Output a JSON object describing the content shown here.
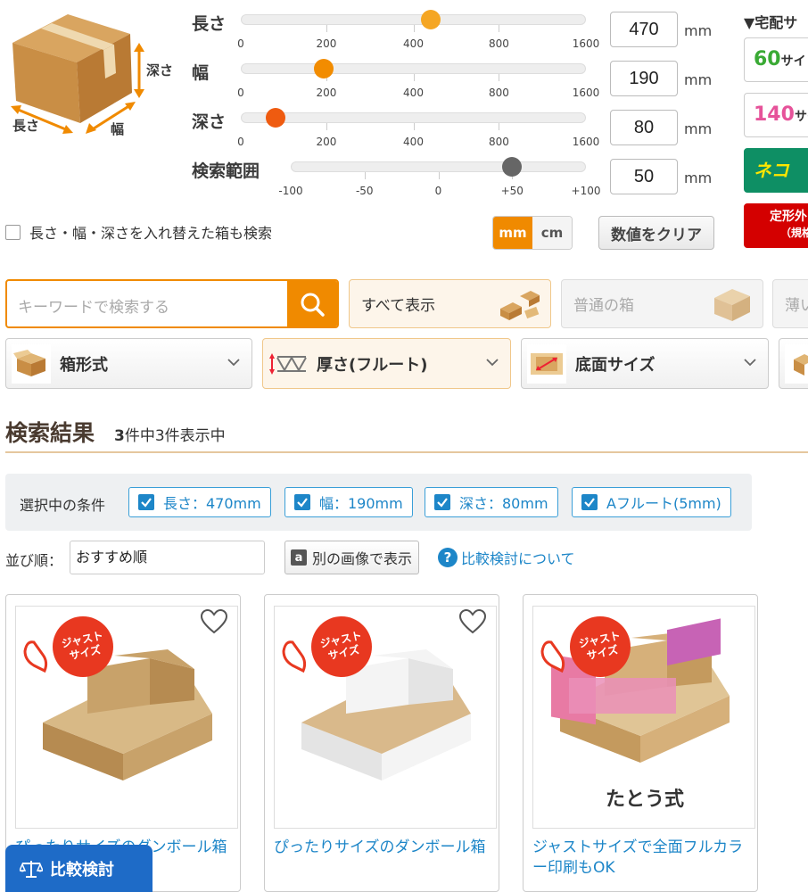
{
  "box_illustration": {
    "depth_label": "深さ",
    "length_label": "長さ",
    "width_label": "幅"
  },
  "sliders": [
    {
      "label": "長さ",
      "value": "470",
      "unit": "mm",
      "ticks": [
        "0",
        "200",
        "400",
        "800",
        "1600"
      ],
      "knob_color": "#f5a623",
      "level": 0.55
    },
    {
      "label": "幅",
      "value": "190",
      "unit": "mm",
      "ticks": [
        "0",
        "200",
        "400",
        "800",
        "1600"
      ],
      "knob_color": "#f28c00",
      "level": 0.24
    },
    {
      "label": "深さ",
      "value": "80",
      "unit": "mm",
      "ticks": [
        "0",
        "200",
        "400",
        "800",
        "1600"
      ],
      "knob_color": "#ef5b10",
      "level": 0.1
    },
    {
      "label": "検索範囲",
      "value": "50",
      "unit": "mm",
      "ticks": [
        "-100",
        "-50",
        "0",
        "+50",
        "+100"
      ],
      "knob_color": "#666666",
      "level": 0.75
    }
  ],
  "right_panel": {
    "title": "▼宅配サ",
    "items": [
      {
        "num": "60",
        "suffix": "サイ",
        "color": "#3aaa35"
      },
      {
        "num": "140",
        "suffix": "サイ",
        "color": "#e6539a"
      },
      {
        "label": "ネコ",
        "bg": "#0e8f64"
      },
      {
        "label": "定形外",
        "sub": "（規格",
        "bg": "#d40000"
      }
    ]
  },
  "swap_option": {
    "label": "長さ・幅・深さを入れ替えた箱も検索",
    "checked": false
  },
  "unit_toggle": {
    "mm": "mm",
    "cm": "cm",
    "active": "mm"
  },
  "clear_button": "数値をクリア",
  "search": {
    "placeholder": "キーワードで検索する"
  },
  "categories": [
    {
      "label": "すべて表示",
      "active": true
    },
    {
      "label": "普通の箱",
      "active": false
    },
    {
      "label": "薄い",
      "active": false
    }
  ],
  "filters": [
    {
      "label": "箱形式",
      "active": false
    },
    {
      "label": "厚さ(フルート)",
      "active": true
    },
    {
      "label": "底面サイズ",
      "active": false
    }
  ],
  "results": {
    "title": "検索結果",
    "count": "3",
    "count_text": "件中3件表示中"
  },
  "conditions": {
    "title": "選択中の条件",
    "chips": [
      "長さ：470mm",
      "幅：190mm",
      "深さ：80mm",
      "Aフルート(5mm)"
    ]
  },
  "sort": {
    "label": "並び順：",
    "value": "おすすめ順"
  },
  "alt_image_button": "別の画像で表示",
  "compare_link": "比較検討について",
  "products": [
    {
      "badge": "ジャストサイズ",
      "title": "ぴったりサイズのダンボール箱",
      "color": "brown",
      "caption": ""
    },
    {
      "badge": "ジャストサイズ",
      "title": "ぴったりサイズのダンボール箱",
      "color": "white",
      "caption": ""
    },
    {
      "badge": "ジャストサイズ",
      "title": "ジャストサイズで全面フルカラー印刷もOK",
      "color": "print",
      "caption": "たとう式"
    }
  ],
  "compare_button": "比較検討"
}
